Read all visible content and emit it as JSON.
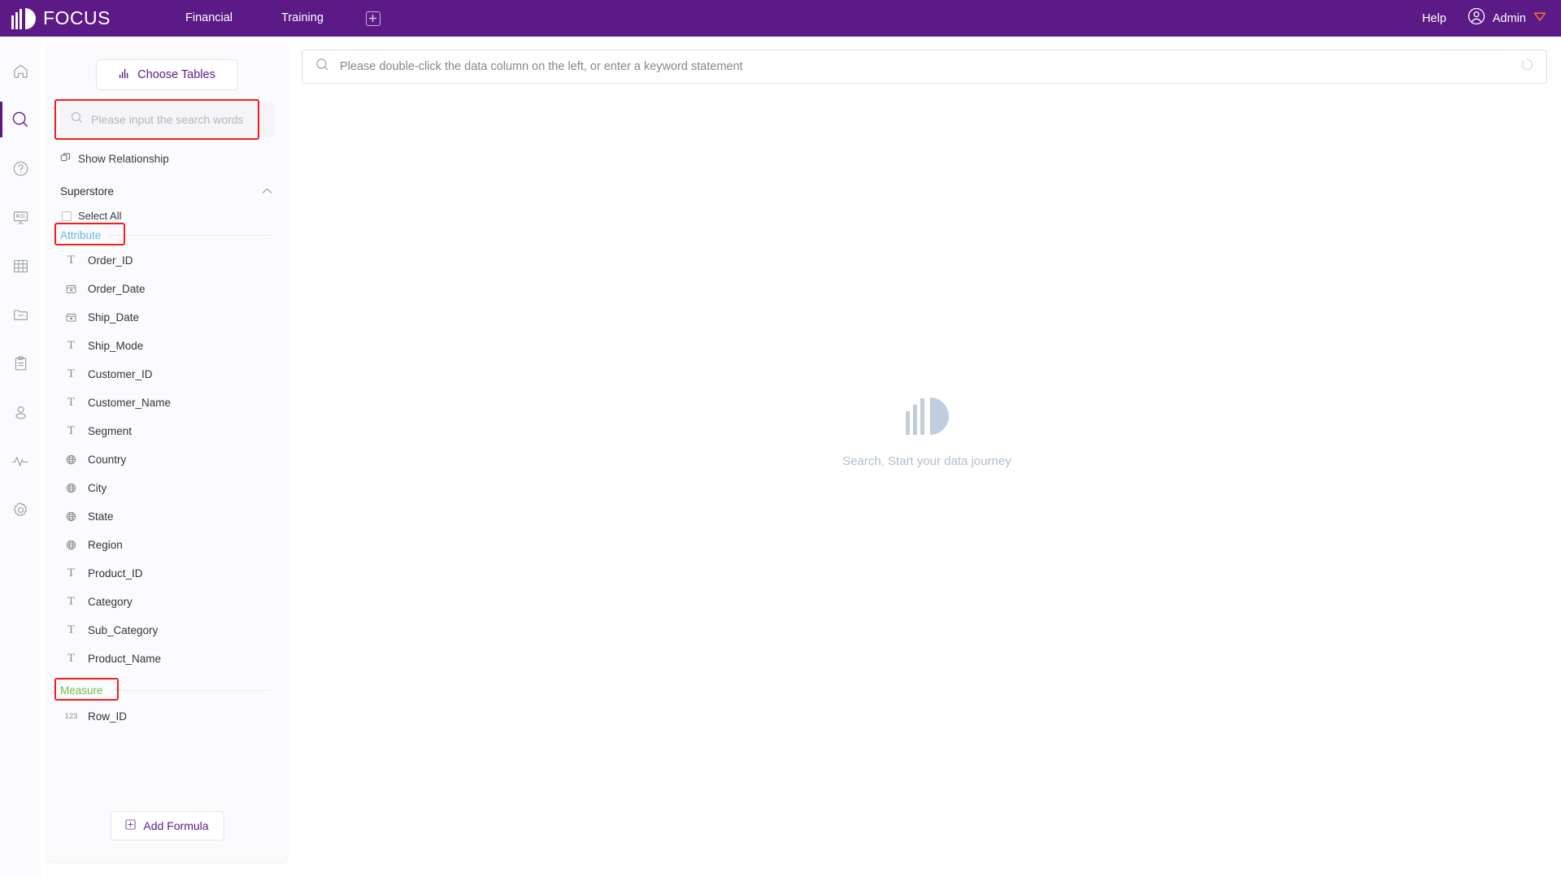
{
  "colors": {
    "brand_purple": "#5b1a86",
    "accent_purple": "#5b1a86",
    "highlight_red": "#f71c1c",
    "attribute_blue": "#62b8ef",
    "measure_green": "#6dc24b",
    "empty_gray": "#c0cddd"
  },
  "topbar": {
    "logo_text": "FOCUS",
    "logo_icon": "focus-logo-icon",
    "tabs": [
      {
        "label": "Financial",
        "name": "financial"
      },
      {
        "label": "Training",
        "name": "training"
      }
    ],
    "add_tab_icon": "plus-square-icon",
    "help_label": "Help",
    "user_icon": "user-circle-icon",
    "user_name": "Admin",
    "user_dropdown_icon": "chevron-down-diamond-icon"
  },
  "rail": {
    "items": [
      {
        "name": "home",
        "icon": "home-icon",
        "active": false
      },
      {
        "name": "search",
        "icon": "search-icon",
        "active": true
      },
      {
        "name": "help",
        "icon": "question-circle-icon",
        "active": false
      },
      {
        "name": "presentation",
        "icon": "presentation-icon",
        "active": false
      },
      {
        "name": "table",
        "icon": "grid-table-icon",
        "active": false
      },
      {
        "name": "folder",
        "icon": "folder-minus-icon",
        "active": false
      },
      {
        "name": "clipboard",
        "icon": "clipboard-icon",
        "active": false
      },
      {
        "name": "user",
        "icon": "user-icon",
        "active": false
      },
      {
        "name": "monitor",
        "icon": "activity-pulse-icon",
        "active": false
      },
      {
        "name": "settings",
        "icon": "gear-icon",
        "active": false
      }
    ]
  },
  "panel": {
    "choose_tables_label": "Choose Tables",
    "choose_tables_icon": "bar-chart-icon",
    "search": {
      "placeholder": "Please input the search words",
      "value": "",
      "icon": "search-icon",
      "highlighted": true
    },
    "show_relationship_label": "Show Relationship",
    "show_relationship_icon": "relationship-icon",
    "table_name": "Superstore",
    "collapse_icon": "chevron-up-icon",
    "select_all_label": "Select All",
    "select_all_checked": false,
    "groups": [
      {
        "label": "Attribute",
        "highlighted": true,
        "fields": [
          {
            "name": "Order_ID",
            "icon": "text-type-icon"
          },
          {
            "name": "Order_Date",
            "icon": "calendar-icon"
          },
          {
            "name": "Ship_Date",
            "icon": "calendar-icon"
          },
          {
            "name": "Ship_Mode",
            "icon": "text-type-icon"
          },
          {
            "name": "Customer_ID",
            "icon": "text-type-icon"
          },
          {
            "name": "Customer_Name",
            "icon": "text-type-icon"
          },
          {
            "name": "Segment",
            "icon": "text-type-icon"
          },
          {
            "name": "Country",
            "icon": "globe-icon"
          },
          {
            "name": "City",
            "icon": "globe-icon"
          },
          {
            "name": "State",
            "icon": "globe-icon"
          },
          {
            "name": "Region",
            "icon": "globe-icon"
          },
          {
            "name": "Product_ID",
            "icon": "text-type-icon"
          },
          {
            "name": "Category",
            "icon": "text-type-icon"
          },
          {
            "name": "Sub_Category",
            "icon": "text-type-icon"
          },
          {
            "name": "Product_Name",
            "icon": "text-type-icon"
          }
        ]
      },
      {
        "label": "Measure",
        "highlighted": true,
        "fields": [
          {
            "name": "Row_ID",
            "icon": "number-type-icon",
            "icon_text": "123"
          }
        ]
      }
    ],
    "add_formula_label": "Add Formula",
    "add_formula_icon": "plus-square-icon"
  },
  "main": {
    "search": {
      "placeholder": "Please double-click the data column on the left, or enter a keyword statement",
      "value": "",
      "icon": "search-icon",
      "spinner_icon": "loading-spinner-icon"
    },
    "empty_state": {
      "icon": "focus-logo-icon",
      "text": "Search, Start your data journey"
    }
  }
}
